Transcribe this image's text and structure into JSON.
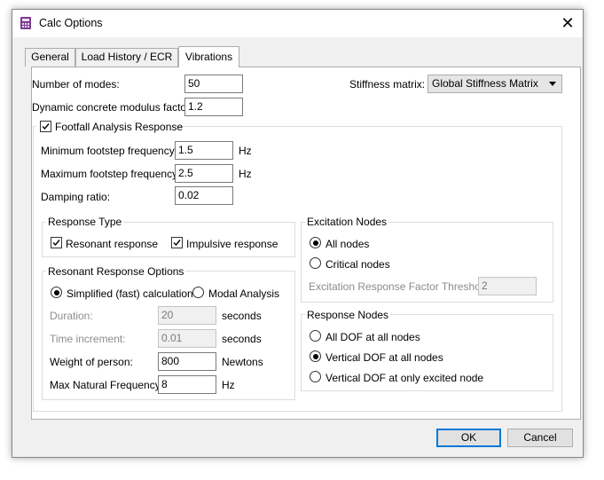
{
  "window": {
    "title": "Calc Options",
    "close_glyph": "✕"
  },
  "tabs": [
    "General",
    "Load History / ECR",
    "Vibrations"
  ],
  "active_tab": "Vibrations",
  "top": {
    "num_modes_label": "Number of modes:",
    "num_modes_value": "50",
    "dyn_label": "Dynamic concrete modulus factor:",
    "dyn_value": "1.2",
    "stiffness_label": "Stiffness matrix:",
    "stiffness_value": "Global Stiffness Matrix"
  },
  "footfall": {
    "label": "Footfall Analysis Response",
    "checked": true,
    "min_label": "Minimum footstep frequency:",
    "min_value": "1.5",
    "max_label": "Maximum footstep frequency:",
    "max_value": "2.5",
    "hz": "Hz",
    "damping_label": "Damping ratio:",
    "damping_value": "0.02"
  },
  "response_type": {
    "legend": "Response Type",
    "resonant": "Resonant response",
    "impulsive": "Impulsive response"
  },
  "resonant_options": {
    "legend": "Resonant Response Options",
    "simplified": "Simplified (fast) calculation",
    "modal": "Modal Analysis",
    "duration_label": "Duration:",
    "duration_value": "20",
    "time_inc_label": "Time increment:",
    "time_inc_value": "0.01",
    "seconds": "seconds",
    "weight_label": "Weight of person:",
    "weight_value": "800",
    "newtons": "Newtons",
    "max_nat_label": "Max Natural Frequency:",
    "max_nat_value": "8",
    "hz": "Hz"
  },
  "excitation": {
    "legend": "Excitation Nodes",
    "all": "All nodes",
    "critical": "Critical nodes",
    "threshold_label": "Excitation Response Factor Threshold:",
    "threshold_value": "2"
  },
  "response_nodes": {
    "legend": "Response Nodes",
    "all_dof": "All DOF at all nodes",
    "vertical_all": "Vertical DOF at all nodes",
    "vertical_excited": "Vertical DOF at only excited node"
  },
  "buttons": {
    "ok": "OK",
    "cancel": "Cancel"
  },
  "colors": {
    "accent": "#0078d7",
    "icon_purple": "#7a3c8c"
  }
}
